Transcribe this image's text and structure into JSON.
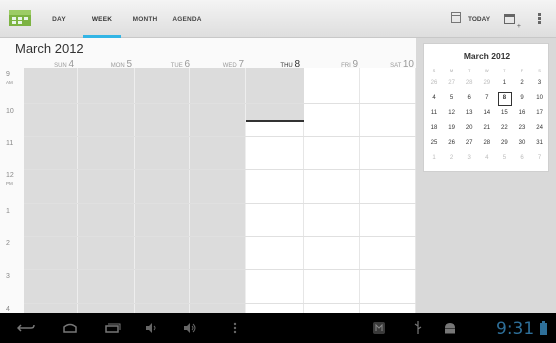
{
  "actionbar": {
    "tabs": [
      {
        "label": "DAY"
      },
      {
        "label": "WEEK"
      },
      {
        "label": "MONTH"
      },
      {
        "label": "AGENDA"
      }
    ],
    "active_tab": "WEEK",
    "today_label": "TODAY",
    "accent_color": "#33b5e5"
  },
  "header": {
    "month_title": "March 2012",
    "days": [
      {
        "dow": "SUN",
        "num": "4"
      },
      {
        "dow": "MON",
        "num": "5"
      },
      {
        "dow": "TUE",
        "num": "6"
      },
      {
        "dow": "WED",
        "num": "7"
      },
      {
        "dow": "THU",
        "num": "8"
      },
      {
        "dow": "FRI",
        "num": "9"
      },
      {
        "dow": "SAT",
        "num": "10"
      }
    ]
  },
  "hours": [
    {
      "h": "9",
      "ampm": "AM"
    },
    {
      "h": "10",
      "ampm": ""
    },
    {
      "h": "11",
      "ampm": ""
    },
    {
      "h": "12",
      "ampm": "PM"
    },
    {
      "h": "1",
      "ampm": ""
    },
    {
      "h": "2",
      "ampm": ""
    },
    {
      "h": "3",
      "ampm": ""
    },
    {
      "h": "4",
      "ampm": ""
    }
  ],
  "mini_calendar": {
    "title": "March 2012",
    "dow": [
      "S",
      "M",
      "T",
      "W",
      "T",
      "F",
      "S"
    ],
    "weeks": [
      [
        "26",
        "27",
        "28",
        "29",
        "1",
        "2",
        "3"
      ],
      [
        "4",
        "5",
        "6",
        "7",
        "8",
        "9",
        "10"
      ],
      [
        "11",
        "12",
        "13",
        "14",
        "15",
        "16",
        "17"
      ],
      [
        "18",
        "19",
        "20",
        "21",
        "22",
        "23",
        "24"
      ],
      [
        "25",
        "26",
        "27",
        "28",
        "29",
        "30",
        "31"
      ],
      [
        "1",
        "2",
        "3",
        "4",
        "5",
        "6",
        "7"
      ]
    ],
    "selected": "8"
  },
  "status": {
    "clock": "9:31"
  }
}
